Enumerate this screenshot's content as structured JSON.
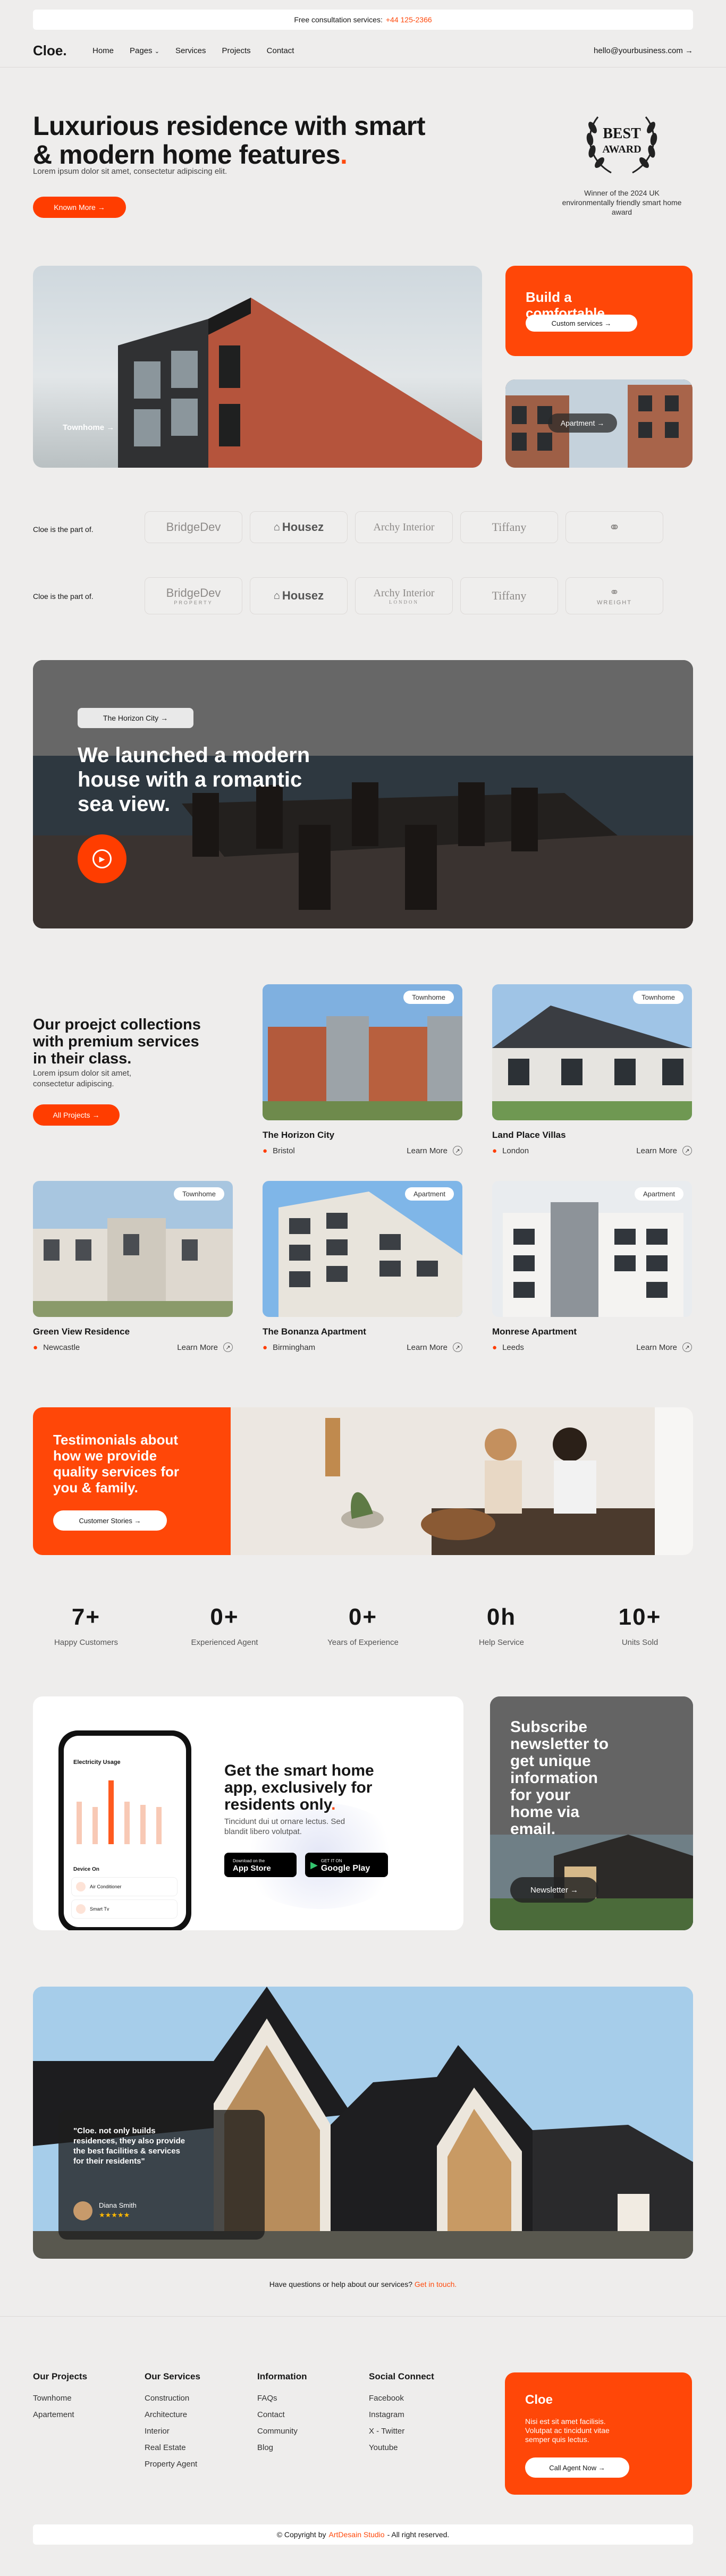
{
  "topbar": {
    "text": "Free consultation services:",
    "phone": "+44 125-2366"
  },
  "nav": {
    "brand": "Cloe.",
    "items": [
      "Home",
      "Pages",
      "Services",
      "Projects",
      "Contact"
    ],
    "email": "hello@yourbusiness.com →"
  },
  "hero": {
    "title_line1": "Luxurious residence with smart",
    "title_line2": "& modern home features",
    "title_dot": ".",
    "subtitle": "Lorem ipsum dolor sit amet, consectetur adipiscing elit.",
    "button": "Known More →",
    "award_top": "BEST",
    "award_bottom": "AWARD",
    "award_caption": "Winner of the 2024 UK environmentally friendly smart home award"
  },
  "showcase": {
    "townhome_label": "Townhome →",
    "apartment_label": "Apartment →",
    "build_title": "Build a comfortable,",
    "build_button": "Custom services →"
  },
  "partners": {
    "label": "Cloe is the part of.",
    "logos": [
      "BridgeDev",
      "Housez",
      "Archy Interior",
      "Tiffany",
      ""
    ],
    "logos_row2": [
      "BridgeDev",
      "Housez",
      "Archy Interior",
      "Tiffany",
      "WREIGHT"
    ],
    "sub_property": "PROPERTY",
    "sub_london": "LONDON"
  },
  "video": {
    "badge": "The Horizon City →",
    "title_l1": "We launched a modern",
    "title_l2": "house with a romantic",
    "title_l3": "sea view."
  },
  "projects": {
    "heading_l1": "Our proejct collections",
    "heading_l2": "with premium services",
    "heading_l3": "in their class.",
    "desc_l1": "Lorem ipsum dolor sit amet,",
    "desc_l2": "consectetur adipiscing.",
    "button": "All Projects →",
    "learn_more": "Learn More",
    "items": [
      {
        "badge": "Townhome",
        "title": "The Horizon City",
        "location": "Bristol"
      },
      {
        "badge": "Townhome",
        "title": "Land Place Villas",
        "location": "London"
      },
      {
        "badge": "Townhome",
        "title": "Green View Residence",
        "location": "Newcastle"
      },
      {
        "badge": "Apartment",
        "title": "The Bonanza Apartment",
        "location": "Birmingham"
      },
      {
        "badge": "Apartment",
        "title": "Monrese Apartment",
        "location": "Leeds"
      }
    ]
  },
  "testimonials": {
    "title_l1": "Testimonials about",
    "title_l2": "how we provide",
    "title_l3": "quality services for",
    "title_l4": "you & family.",
    "button": "Customer Stories →"
  },
  "stats": [
    {
      "value": "7+",
      "label": "Happy Customers"
    },
    {
      "value": "0+",
      "label": "Experienced Agent"
    },
    {
      "value": "0+",
      "label": "Years of Experience"
    },
    {
      "value": "0h",
      "label": "Help Service"
    },
    {
      "value": "10+",
      "label": "Units Sold"
    }
  ],
  "app": {
    "title_l1": "Get the smart home",
    "title_l2": "app, exclusively for",
    "title_l3": "residents only",
    "title_dot": ".",
    "desc_l1": "Tincidunt dui ut ornare lectus. Sed",
    "desc_l2": "blandit libero volutpat.",
    "appstore_small": "Download on the",
    "appstore": "App Store",
    "gplay_small": "GET IT ON",
    "gplay": "Google Play",
    "phone_title": "Electricity Usage",
    "phone_device": "Device On",
    "phone_item1": "Air Conditioner",
    "phone_item2": "Smart Tv"
  },
  "newsletter": {
    "title_l1": "Subscribe",
    "title_l2": "newsletter to",
    "title_l3": "get unique",
    "title_l4": "information",
    "title_l5": "for your",
    "title_l6": "home via",
    "title_l7": "email.",
    "button": "Newsletter →"
  },
  "quote": {
    "text_l1": "\"Cloe. not only builds",
    "text_l2": "residences, they also provide",
    "text_l3": "the best facilities & services",
    "text_l4": "for their residents\"",
    "author": "Diana Smith",
    "stars": "★★★★★"
  },
  "help": {
    "text": "Have questions or help about our services?",
    "link": "Get in touch."
  },
  "footer": {
    "cols": [
      {
        "title": "Our Projects",
        "links": [
          "Townhome",
          "Apartement"
        ]
      },
      {
        "title": "Our Services",
        "links": [
          "Construction",
          "Architecture",
          "Interior",
          "Real Estate",
          "Property Agent"
        ]
      },
      {
        "title": "Information",
        "links": [
          "FAQs",
          "Contact",
          "Community",
          "Blog"
        ]
      },
      {
        "title": "Social Connect",
        "links": [
          "Facebook",
          "Instagram",
          "X - Twitter",
          "Youtube"
        ]
      }
    ],
    "cta_brand": "Cloe",
    "cta_l1": "Nisi est sit amet facilisis.",
    "cta_l2": "Volutpat ac tincidunt vitae",
    "cta_l3": "semper quis lectus.",
    "cta_button": "Call Agent Now →",
    "copyright": "© Copyright by",
    "copyright_link": "ArtDesain Studio",
    "copyright_end": "- All right reserved."
  }
}
